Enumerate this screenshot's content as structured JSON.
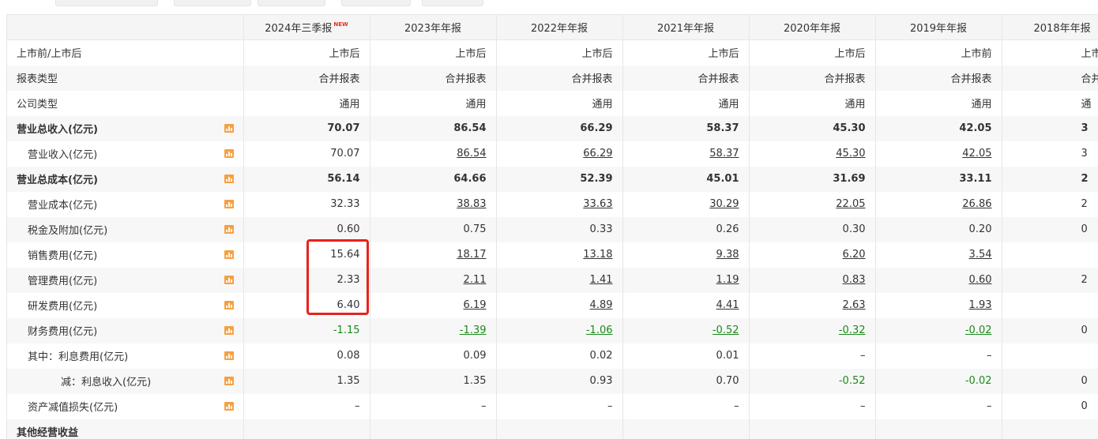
{
  "columns": [
    "2024年三季报",
    "2023年年报",
    "2022年年报",
    "2021年年报",
    "2020年年报",
    "2019年年报",
    "2018年年报"
  ],
  "new_badge": "NEW",
  "rows": [
    {
      "label": "上市前/上市后",
      "style": "plain",
      "chart": false,
      "values": [
        "上市后",
        "上市后",
        "上市后",
        "上市后",
        "上市后",
        "上市前",
        "上市"
      ]
    },
    {
      "label": "报表类型",
      "style": "plain",
      "chart": false,
      "values": [
        "合并报表",
        "合并报表",
        "合并报表",
        "合并报表",
        "合并报表",
        "合并报表",
        "合并报"
      ]
    },
    {
      "label": "公司类型",
      "style": "plain",
      "chart": false,
      "values": [
        "通用",
        "通用",
        "通用",
        "通用",
        "通用",
        "通用",
        "通"
      ]
    },
    {
      "label": "营业总收入(亿元)",
      "style": "bold",
      "chart": true,
      "values": [
        "70.07",
        "86.54",
        "66.29",
        "58.37",
        "45.30",
        "42.05",
        "3"
      ]
    },
    {
      "label": "营业收入(亿元)",
      "style": "indent1",
      "chart": true,
      "values": [
        "70.07",
        "86.54",
        "66.29",
        "58.37",
        "45.30",
        "42.05",
        "3"
      ],
      "link": true
    },
    {
      "label": "营业总成本(亿元)",
      "style": "bold",
      "chart": true,
      "values": [
        "56.14",
        "64.66",
        "52.39",
        "45.01",
        "31.69",
        "33.11",
        "2"
      ]
    },
    {
      "label": "营业成本(亿元)",
      "style": "indent1",
      "chart": true,
      "values": [
        "32.33",
        "38.83",
        "33.63",
        "30.29",
        "22.05",
        "26.86",
        "2"
      ],
      "link": true
    },
    {
      "label": "税金及附加(亿元)",
      "style": "indent1",
      "chart": true,
      "values": [
        "0.60",
        "0.75",
        "0.33",
        "0.26",
        "0.30",
        "0.20",
        "0"
      ]
    },
    {
      "label": "销售费用(亿元)",
      "style": "indent1",
      "chart": true,
      "values": [
        "15.64",
        "18.17",
        "13.18",
        "9.38",
        "6.20",
        "3.54",
        ""
      ],
      "link": true
    },
    {
      "label": "管理费用(亿元)",
      "style": "indent1",
      "chart": true,
      "values": [
        "2.33",
        "2.11",
        "1.41",
        "1.19",
        "0.83",
        "0.60",
        "2"
      ],
      "link": true
    },
    {
      "label": "研发费用(亿元)",
      "style": "indent1",
      "chart": true,
      "values": [
        "6.40",
        "6.19",
        "4.89",
        "4.41",
        "2.63",
        "1.93",
        ""
      ],
      "link": true
    },
    {
      "label": "财务费用(亿元)",
      "style": "indent1",
      "chart": true,
      "values": [
        "-1.15",
        "-1.39",
        "-1.06",
        "-0.52",
        "-0.32",
        "-0.02",
        "0"
      ],
      "link": true
    },
    {
      "label": "其中：利息费用(亿元)",
      "style": "indent1",
      "chart": true,
      "values": [
        "0.08",
        "0.09",
        "0.02",
        "0.01",
        "–",
        "–",
        ""
      ]
    },
    {
      "label": "减：利息收入(亿元)",
      "style": "indent2",
      "chart": true,
      "values": [
        "1.35",
        "1.35",
        "0.93",
        "0.70",
        "-0.52",
        "-0.02",
        "0"
      ]
    },
    {
      "label": "资产减值损失(亿元)",
      "style": "indent1",
      "chart": true,
      "values": [
        "–",
        "–",
        "–",
        "–",
        "–",
        "–",
        "0"
      ]
    },
    {
      "label": "其他经营收益",
      "style": "bold",
      "chart": false,
      "values": [
        "",
        "",
        "",
        "",
        "",
        "",
        ""
      ]
    }
  ]
}
